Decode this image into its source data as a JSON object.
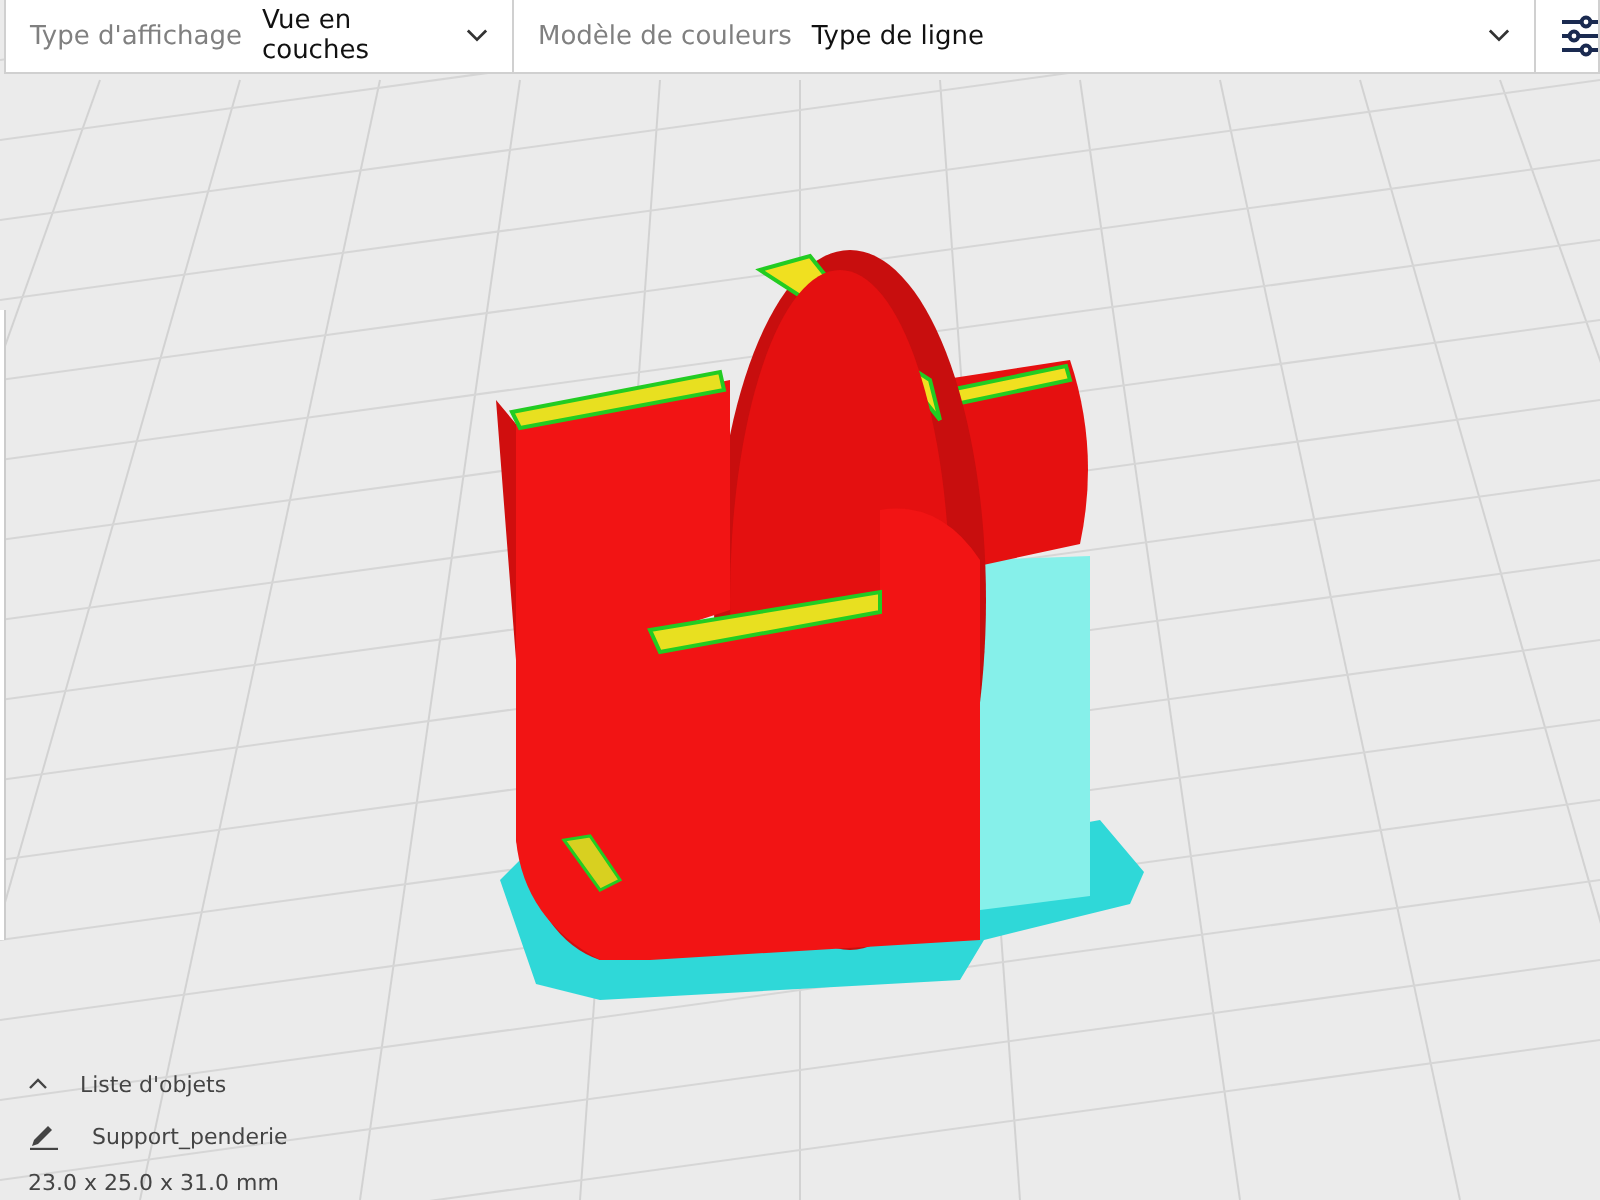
{
  "toolbar": {
    "view_type": {
      "label": "Type d'affichage",
      "value": "Vue en couches"
    },
    "color_scheme": {
      "label": "Modèle de couleurs",
      "value": "Type de ligne"
    }
  },
  "object_list": {
    "title": "Liste d'objets",
    "expanded": true,
    "object_name": "Support_penderie",
    "dimensions": "23.0 x 25.0 x 31.0 mm"
  }
}
